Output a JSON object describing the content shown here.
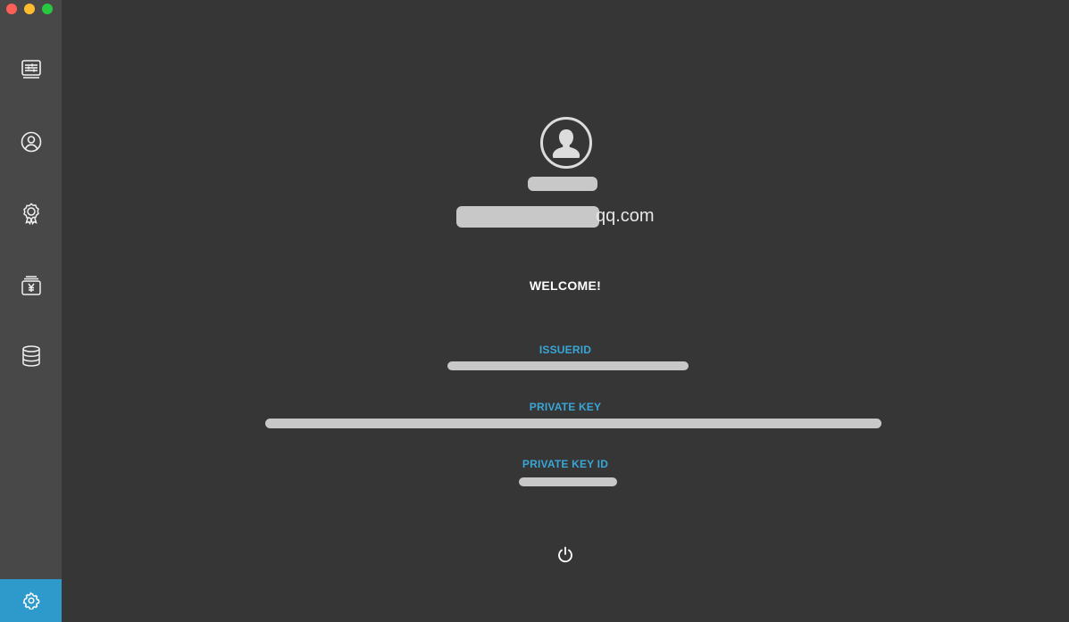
{
  "window": {
    "controls": [
      "close",
      "minimize",
      "maximize"
    ]
  },
  "sidebar": {
    "items": [
      {
        "icon": "sliders-monitor-icon",
        "active": false
      },
      {
        "icon": "user-circle-icon",
        "active": false
      },
      {
        "icon": "certificate-badge-icon",
        "active": false
      },
      {
        "icon": "yen-wallet-icon",
        "active": false
      },
      {
        "icon": "database-icon",
        "active": false
      }
    ],
    "settings": {
      "icon": "gear-icon",
      "active": true
    }
  },
  "profile": {
    "email_visible_suffix": "qq.com",
    "welcome": "WELCOME!"
  },
  "fields": {
    "issuer_id_label": "ISSUERID",
    "private_key_label": "PRIVATE KEY",
    "private_key_id_label": "PRIVATE KEY ID"
  },
  "actions": {
    "logout_icon": "power-icon"
  },
  "colors": {
    "background": "#363636",
    "sidebar": "#484848",
    "accent": "#2e9acb",
    "label": "#39a6d6"
  }
}
